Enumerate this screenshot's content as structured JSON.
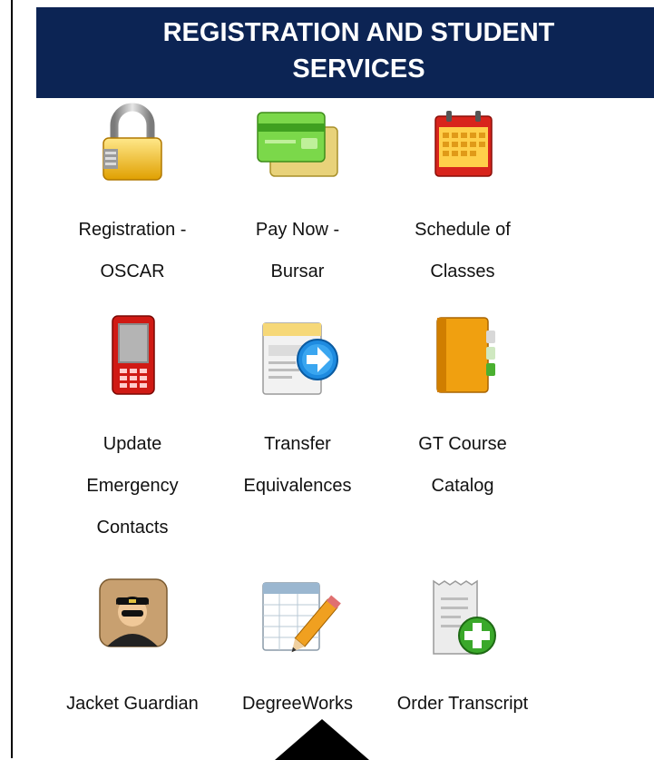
{
  "header": {
    "title_line1": "REGISTRATION AND STUDENT",
    "title_line2": "SERVICES"
  },
  "colors": {
    "header_bg": "#0c2454",
    "header_text": "#ffffff"
  },
  "tiles": [
    {
      "label": "Registration -\nOSCAR",
      "icon": "padlock-icon"
    },
    {
      "label": "Pay Now -\nBursar",
      "icon": "credit-cards-icon"
    },
    {
      "label": "Schedule of\nClasses",
      "icon": "calendar-icon"
    },
    {
      "label": "Update\nEmergency\nContacts",
      "icon": "mobile-phone-icon"
    },
    {
      "label": "Transfer\nEquivalences",
      "icon": "document-transfer-icon"
    },
    {
      "label": "GT Course\nCatalog",
      "icon": "binder-catalog-icon"
    },
    {
      "label": "Jacket Guardian",
      "icon": "security-guard-icon"
    },
    {
      "label": "DegreeWorks",
      "icon": "spreadsheet-pencil-icon"
    },
    {
      "label": "Order Transcript",
      "icon": "receipt-add-icon"
    }
  ],
  "pointer": {
    "icon": "up-arrow-pointer-icon"
  }
}
